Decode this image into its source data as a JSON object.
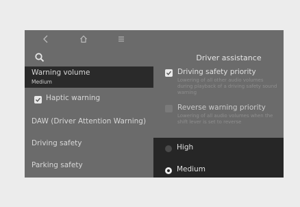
{
  "topbar": {
    "icons": [
      "back-icon",
      "home-icon",
      "menu-icon"
    ]
  },
  "left_menu": {
    "items": [
      {
        "title": "Warning volume",
        "sub": "Medium",
        "selected": true
      },
      {
        "title": "Haptic warning",
        "checked": true
      },
      {
        "title": "DAW (Driver Attention Warning)"
      },
      {
        "title": "Driving safety"
      },
      {
        "title": "Parking safety"
      }
    ]
  },
  "right_panel": {
    "title": "Driver assistance",
    "options": [
      {
        "label": "Driving safety priority",
        "checked": true,
        "desc": "Lowering of all other audio volumes during playback of a driving safety sound warning"
      },
      {
        "label": "Reverse warning priority",
        "checked": false,
        "desc": "Lowering of all audio volumes when the shift lever is set to reverse"
      }
    ]
  },
  "volume_dropdown": {
    "options": [
      "High",
      "Medium"
    ],
    "selected": "Medium"
  },
  "colors": {
    "screen_bg": "#6b6b6b",
    "selected_bg": "#2a2a2a",
    "dropdown_bg": "#262626"
  }
}
